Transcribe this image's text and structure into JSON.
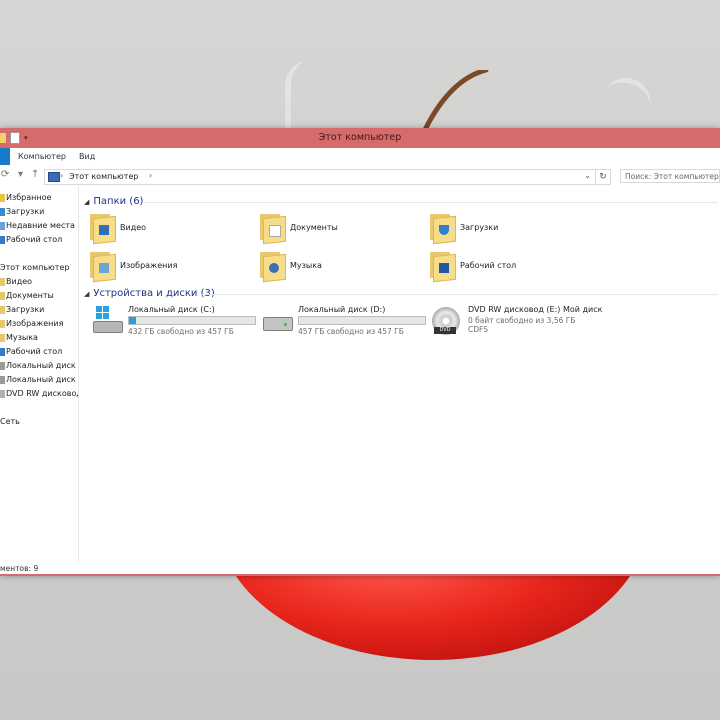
{
  "window": {
    "title": "Этот компьютер",
    "accent_color": "#d76a6a"
  },
  "ribbon": {
    "tabs": [
      "Компьютер",
      "Вид"
    ]
  },
  "address": {
    "crumb": "Этот компьютер",
    "search_placeholder": "Поиск: Этот компьютер"
  },
  "navpane": {
    "items": [
      {
        "label": "Избранное",
        "icon": "star-icon"
      },
      {
        "label": "Загрузки",
        "icon": "downloads-icon"
      },
      {
        "label": "Недавние места",
        "icon": "recent-places-icon"
      },
      {
        "label": "Рабочий стол",
        "icon": "desktop-icon"
      },
      {
        "label": "Этот компьютер",
        "icon": "computer-icon"
      },
      {
        "label": "Видео",
        "icon": "video-folder-icon"
      },
      {
        "label": "Документы",
        "icon": "documents-folder-icon"
      },
      {
        "label": "Загрузки",
        "icon": "downloads-folder-icon"
      },
      {
        "label": "Изображения",
        "icon": "pictures-folder-icon"
      },
      {
        "label": "Музыка",
        "icon": "music-folder-icon"
      },
      {
        "label": "Рабочий стол",
        "icon": "desktop-folder-icon"
      },
      {
        "label": "Локальный диск (C",
        "icon": "drive-icon"
      },
      {
        "label": "Локальный диск (D",
        "icon": "drive-icon"
      },
      {
        "label": "DVD RW дисковод (",
        "icon": "dvd-icon"
      },
      {
        "label": "Сеть",
        "icon": "network-icon"
      }
    ]
  },
  "folders_group": {
    "title": "Папки (6)",
    "items": [
      {
        "label": "Видео",
        "icon": "video-folder-icon"
      },
      {
        "label": "Документы",
        "icon": "documents-folder-icon"
      },
      {
        "label": "Загрузки",
        "icon": "downloads-folder-icon"
      },
      {
        "label": "Изображения",
        "icon": "pictures-folder-icon"
      },
      {
        "label": "Музыка",
        "icon": "music-folder-icon"
      },
      {
        "label": "Рабочий стол",
        "icon": "desktop-folder-icon"
      }
    ]
  },
  "drives_group": {
    "title": "Устройства и диски (3)",
    "items": [
      {
        "name": "Локальный диск (C:)",
        "free": "432 ГБ свободно из 457 ГБ",
        "used_fraction": 0.055,
        "icon": "windows-drive-icon"
      },
      {
        "name": "Локальный диск (D:)",
        "free": "457 ГБ свободно из 457 ГБ",
        "used_fraction": 0.0,
        "icon": "drive-icon"
      },
      {
        "name": "DVD RW дисковод (E:) Мой диск",
        "free": "0 байт свободно из 3,56 ГБ",
        "fs": "CDFS",
        "icon": "dvd-drive-icon"
      }
    ]
  },
  "status": {
    "text": "ментов: 9"
  }
}
